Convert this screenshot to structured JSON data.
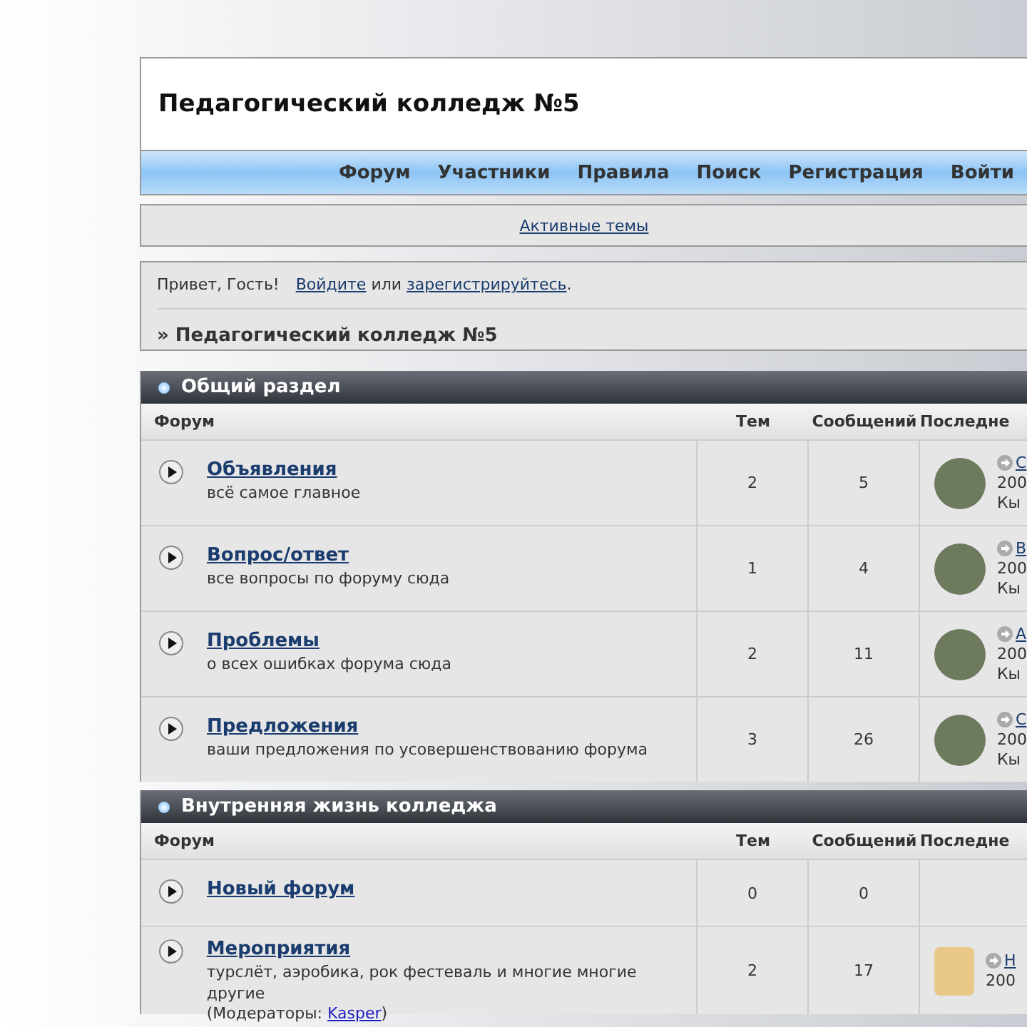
{
  "header": {
    "title": "Педагогический колледж №5"
  },
  "nav": [
    {
      "label": "Форум"
    },
    {
      "label": "Участники"
    },
    {
      "label": "Правила"
    },
    {
      "label": "Поиск"
    },
    {
      "label": "Регистрация"
    },
    {
      "label": "Войти"
    }
  ],
  "subnav": {
    "link": "Активные темы"
  },
  "welcome": {
    "greeting": "Привет, Гость!",
    "login": "Войдите",
    "or": "или",
    "register": "зарегистрируйтесь",
    "end": "."
  },
  "breadcrumb": "» Педагогический колледж №5",
  "categories": [
    {
      "title": "Общий раздел",
      "columns": {
        "forum": "Форум",
        "topics": "Тем",
        "posts": "Сообщений",
        "last": "Последне"
      },
      "forums": [
        {
          "title": "Объявления",
          "description": "всё самое главное",
          "topics": "2",
          "posts": "5",
          "last_post": {
            "kind": "photo",
            "topic": "С",
            "date": "200",
            "author": "Кы"
          }
        },
        {
          "title": "Вопрос/ответ",
          "description": "все вопросы по форуму сюда",
          "topics": "1",
          "posts": "4",
          "last_post": {
            "kind": "photo",
            "topic": "В",
            "date": "200",
            "author": "Кы"
          }
        },
        {
          "title": "Проблемы",
          "description": "о всех ошибках форума сюда",
          "topics": "2",
          "posts": "11",
          "last_post": {
            "kind": "photo",
            "topic": "А",
            "date": "200",
            "author": "Кы"
          }
        },
        {
          "title": "Предложения",
          "description": "ваши предложения по усовершенствованию форума",
          "topics": "3",
          "posts": "26",
          "last_post": {
            "kind": "photo",
            "topic": "С",
            "date": "200",
            "author": "Кы"
          }
        }
      ]
    },
    {
      "title": "Внутренняя жизнь колледжа",
      "columns": {
        "forum": "Форум",
        "topics": "Тем",
        "posts": "Сообщений",
        "last": "Последне"
      },
      "forums": [
        {
          "title": "Новый форум",
          "topics": "0",
          "posts": "0"
        },
        {
          "title": "Мероприятия",
          "description": "турслёт, аэробика, рок фестеваль и многие многие другие",
          "moderators": {
            "prefix": "(Модераторы: ",
            "name": "Kasper",
            "suffix": ")"
          },
          "topics": "2",
          "posts": "17",
          "last_post": {
            "kind": "picture",
            "topic": "Н",
            "date": "200"
          }
        }
      ]
    }
  ]
}
